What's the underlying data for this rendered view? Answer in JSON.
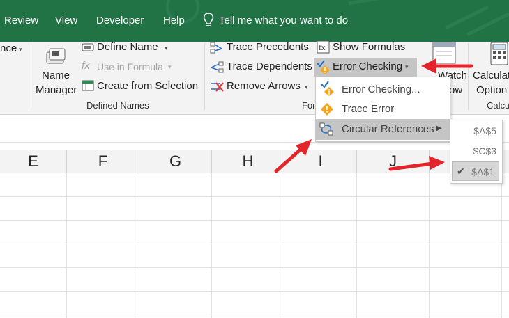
{
  "tabs": [
    "Review",
    "View",
    "Developer",
    "Help"
  ],
  "tell_me": "Tell me what you want to do",
  "ribbon": {
    "partial_left": "nce",
    "name_manager": [
      "Name",
      "Manager"
    ],
    "define_name": "Define Name",
    "use_in_formula": "Use in Formula",
    "create_from_selection": "Create from Selection",
    "defined_names_group": "Defined Names",
    "trace_precedents": "Trace Precedents",
    "trace_dependents": "Trace Dependents",
    "remove_arrows": "Remove Arrows",
    "show_formulas": "Show Formulas",
    "error_checking": "Error Checking",
    "formula_auditing_partial": "For",
    "watch_window": [
      "Watch",
      "ow"
    ],
    "calc_options": [
      "Calculat",
      "Option"
    ],
    "calc_group_partial": "Calcu"
  },
  "menu": {
    "items": [
      "Error Checking...",
      "Trace Error",
      "Circular References"
    ]
  },
  "submenu": {
    "items": [
      "$A$5",
      "$C$3",
      "$A$1"
    ],
    "checked": "$A$1"
  },
  "columns": [
    "E",
    "F",
    "G",
    "H",
    "I",
    "J"
  ],
  "colors": {
    "tab_green": "#217346",
    "arrow_red": "#e3242b",
    "highlight": "#c5c5c5"
  }
}
